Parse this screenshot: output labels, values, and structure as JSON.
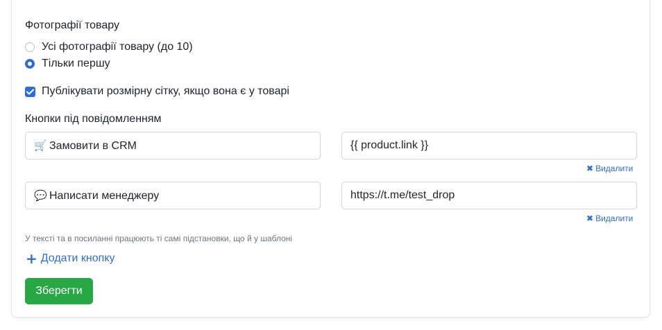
{
  "photos": {
    "heading": "Фотографії товару",
    "options": [
      {
        "label": "Усі фотографії товару (до 10)",
        "selected": false
      },
      {
        "label": "Тільки першу",
        "selected": true
      }
    ]
  },
  "size_chart": {
    "label": "Публікувати розмірну сітку, якщо вона є у товарі",
    "checked": true
  },
  "buttons": {
    "heading": "Кнопки під повідомленням",
    "rows": [
      {
        "icon": "shopping-cart-icon",
        "emoji": "🛒",
        "text": "Замовити в CRM",
        "url": "{{ product.link }}",
        "delete_label": "Видалити"
      },
      {
        "icon": "speech-bubble-icon",
        "emoji": "💬",
        "text": "Написати менеджеру",
        "url": "https://t.me/test_drop",
        "delete_label": "Видалити"
      }
    ],
    "help": "У тексті та в посиланні працюють ті самі підстановки, що й у шаблоні",
    "add_label": "Додати кнопку"
  },
  "save_label": "Зберегти",
  "colors": {
    "accent": "#2b6fd6",
    "save": "#28a745",
    "border": "#ced4da"
  }
}
